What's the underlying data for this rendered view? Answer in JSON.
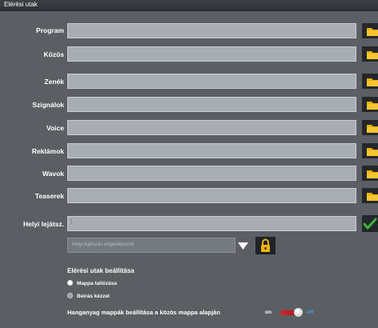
{
  "window": {
    "title": "Elérési utak"
  },
  "paths": [
    {
      "label": "Program",
      "value": ""
    },
    {
      "label": "Közös",
      "value": ""
    },
    {
      "label": "Zenék",
      "value": ""
    },
    {
      "label": "Szignálok",
      "value": ""
    },
    {
      "label": "Voice",
      "value": ""
    },
    {
      "label": "Reklámok",
      "value": ""
    },
    {
      "label": "Wavok",
      "value": ""
    },
    {
      "label": "Teaserek",
      "value": ""
    }
  ],
  "local_play": {
    "label": "Helyi lejátsz.",
    "value": "\\",
    "combo_placeholder": "Helyi lejátszás engedélyezve"
  },
  "settings": {
    "title": "Elérési utak beállítása",
    "option_browse": "Mappa tallózása",
    "option_manual": "Beírás kézzel",
    "selected": "option_browse"
  },
  "toggle": {
    "label": "Hanganyag mappák beállítása a közös mappa alapján",
    "on_label": "on",
    "off_label": "off",
    "state": "off"
  },
  "colors": {
    "accent_blue": "#3aa0ff",
    "folder_yellow": "#f0b000",
    "check_green": "#3fb83a",
    "lock_yellow": "#f2b400"
  }
}
